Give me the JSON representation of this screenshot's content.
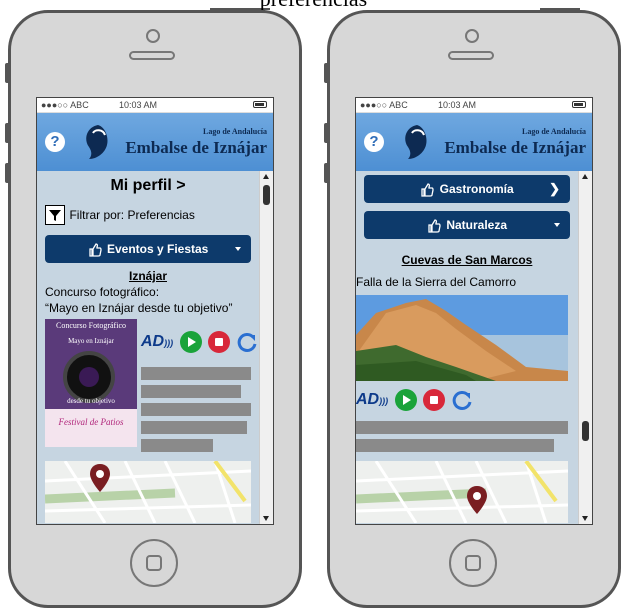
{
  "caption": "preferencias",
  "left_phone": {
    "status": {
      "carrier": "●●●○○ ABC",
      "time": "10:03 AM"
    },
    "header": {
      "help_label": "?",
      "subtitle": "Lago de Andalucía",
      "title": "Embalse de Iznájar"
    },
    "profile_title": "Mi perfil >",
    "filter_label": "Filtrar por: Preferencias",
    "category_button": "Eventos y Fiestas",
    "place_heading": "Iznájar",
    "event_line1": "Concurso fotográfico:",
    "event_line2": "“Mayo en Iznájar desde tu objetivo”",
    "poster": {
      "title": "Concurso Fotográfico",
      "subtitle": "Mayo en Iznájar",
      "footer": "desde tu objetivo",
      "bottom": "Festival de Patios"
    },
    "audio": {
      "ad_label": "AD"
    }
  },
  "right_phone": {
    "status": {
      "carrier": "●●●○○ ABC",
      "time": "10:03 AM"
    },
    "header": {
      "help_label": "?",
      "subtitle": "Lago de Andalucía",
      "title": "Embalse de Iznájar"
    },
    "buttons": [
      {
        "label": "Gastronomía"
      },
      {
        "label": "Naturaleza"
      }
    ],
    "place_heading": "Cuevas de San Marcos",
    "place_sub": "Falla de la Sierra del Camorro",
    "audio": {
      "ad_label": "AD"
    }
  },
  "colors": {
    "header": "#4d8fd3",
    "button": "#0d3a6b",
    "content_bg": "#c6d5e1",
    "marker": "#7a1e22"
  }
}
